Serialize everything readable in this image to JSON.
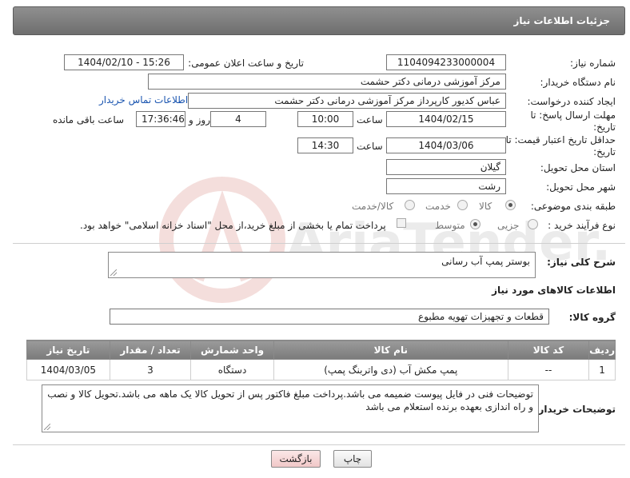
{
  "header": {
    "title": "جزئیات اطلاعات نیاز"
  },
  "fields": {
    "need_number": {
      "label": "شماره نیاز:",
      "value": "1104094233000004"
    },
    "announce": {
      "label": "تاریخ و ساعت اعلان عمومی:",
      "value": "1404/02/10 - 15:26"
    },
    "buyer_org": {
      "label": "نام دستگاه خریدار:",
      "value": "مرکز آموزشی درمانی دکتر حشمت"
    },
    "creator": {
      "label": "ایجاد کننده درخواست:",
      "value": "عباس کدیور کارپرداز مرکز آموزشی درمانی دکتر حشمت",
      "contact_link": "اطلاعات تماس خریدار"
    },
    "deadline": {
      "label": "مهلت ارسال پاسخ: تا تاریخ:",
      "date": "1404/02/15",
      "time_label": "ساعت",
      "time": "10:00",
      "days": "4",
      "days_label": "روز و",
      "remaining": "17:36:46",
      "remaining_label": "ساعت باقی مانده"
    },
    "min_price_validity": {
      "label": "حداقل تاریخ اعتبار قیمت: تا تاریخ:",
      "date": "1404/03/06",
      "time_label": "ساعت",
      "time": "14:30"
    },
    "province": {
      "label": "استان محل تحویل:",
      "value": "گیلان"
    },
    "city": {
      "label": "شهر محل تحویل:",
      "value": "رشت"
    },
    "category": {
      "label": "طبقه بندی موضوعی:",
      "options": [
        "کالا",
        "خدمت",
        "کالا/خدمت"
      ],
      "selected": "کالا"
    },
    "purchase_type": {
      "label": "نوع فرآیند خرید :",
      "options": [
        "جزیی",
        "متوسط"
      ],
      "selected": "متوسط",
      "note": "پرداخت تمام یا بخشی از مبلغ خرید،از محل \"اسناد خزانه اسلامی\" خواهد بود."
    }
  },
  "description": {
    "label": "شرح کلی نیاز:",
    "value": "بوستر پمپ آب رسانی"
  },
  "goods_section": {
    "title": "اطلاعات کالاهای مورد نیاز",
    "group_label": "گروه کالا:",
    "group_value": "قطعات و تجهیزات تهویه مطبوع"
  },
  "table": {
    "headers": [
      "ردیف",
      "کد کالا",
      "نام کالا",
      "واحد شمارش",
      "تعداد / مقدار",
      "تاریخ نیاز"
    ],
    "rows": [
      [
        "1",
        "--",
        "پمپ مکش آب (دی واتربنگ پمپ)",
        "دستگاه",
        "3",
        "1404/03/05"
      ]
    ]
  },
  "buyer_notes": {
    "label": "توضیحات خریدار:",
    "value": "توضیحات فنی در فایل پیوست ضمیمه می باشد.پرداخت مبلغ فاکتور پس از تحویل کالا یک ماهه می باشد.تحویل کالا و نصب و راه اندازی بعهده برنده استعلام می باشد"
  },
  "buttons": {
    "print": "چاپ",
    "back": "بازگشت"
  },
  "colors": {
    "header_bg": "#7b7b7b",
    "link": "#1a55b0",
    "back_button": "#f1c8c8"
  }
}
